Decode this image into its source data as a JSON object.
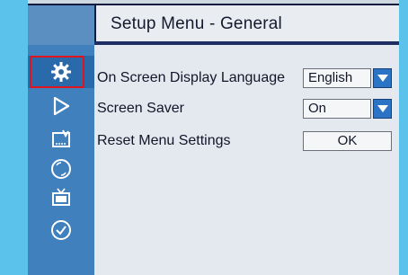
{
  "header": {
    "title": "Setup Menu - General"
  },
  "sidebar": {
    "items": [
      {
        "name": "general",
        "icon": "gear-icon",
        "active": true
      },
      {
        "name": "playback",
        "icon": "play-icon",
        "active": false
      },
      {
        "name": "audio",
        "icon": "speaker-icon",
        "active": false
      },
      {
        "name": "disc",
        "icon": "disc-icon",
        "active": false
      },
      {
        "name": "video",
        "icon": "tv-icon",
        "active": false
      },
      {
        "name": "clock",
        "icon": "clock-icon",
        "active": false
      }
    ]
  },
  "settings": {
    "language_label": "On Screen Display Language",
    "language_value": "English",
    "screensaver_label": "Screen Saver",
    "screensaver_value": "On",
    "reset_label": "Reset Menu Settings",
    "reset_button": "OK"
  },
  "colors": {
    "background": "#5bc2ec",
    "frame": "#121c3e",
    "sidebar": "#3f80bd",
    "content": "#e4e8ef",
    "active_outline": "#e0141c",
    "dropdown": "#2b73c4"
  }
}
